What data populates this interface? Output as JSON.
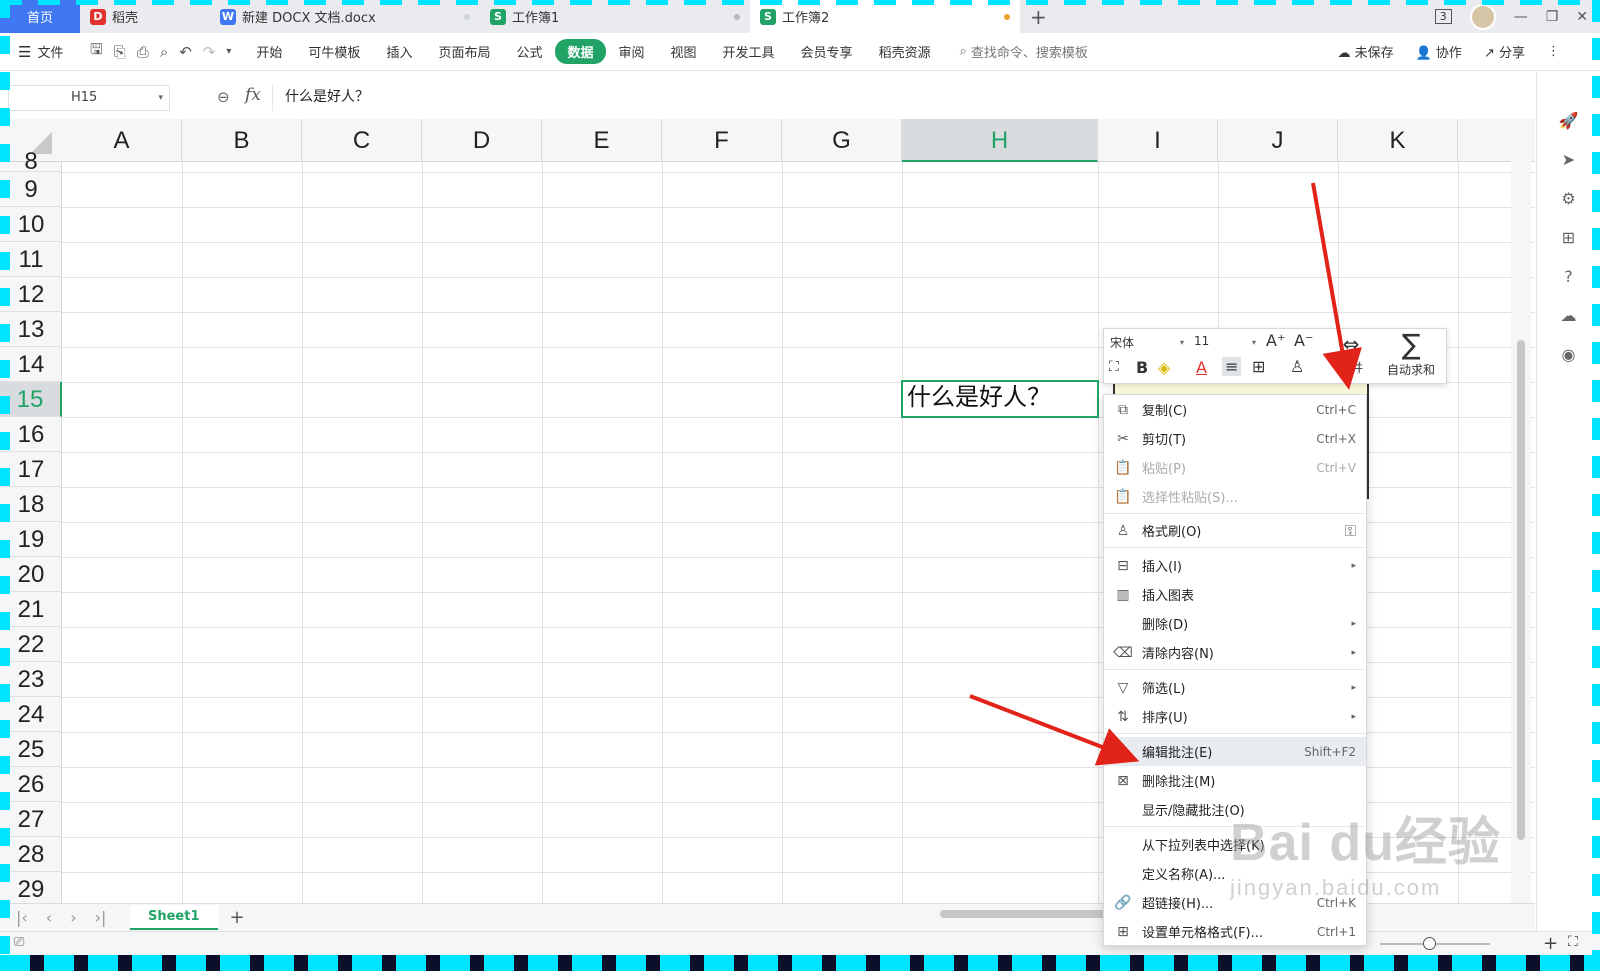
{
  "tabs": [
    {
      "label": "首页",
      "icon": "home"
    },
    {
      "label": "稻壳",
      "icon": "docer-icon",
      "badge": "D"
    },
    {
      "label": "新建 DOCX 文档.docx",
      "icon": "word-icon",
      "badge": "W"
    },
    {
      "label": "工作簿1",
      "icon": "sheet-icon",
      "badge": "S"
    },
    {
      "label": "工作簿2",
      "icon": "sheet-icon",
      "badge": "S"
    }
  ],
  "tabbar_right": {
    "counter": "3"
  },
  "ribbon": {
    "file_label": "文件",
    "tabs": [
      "开始",
      "可牛模板",
      "插入",
      "页面布局",
      "公式",
      "数据",
      "审阅",
      "视图",
      "开发工具",
      "会员专享",
      "稻壳资源"
    ],
    "active_tab": "数据",
    "search_placeholder": "查找命令、搜索模板",
    "right": {
      "unsaved": "未保存",
      "collab": "协作",
      "share": "分享"
    }
  },
  "formula_bar": {
    "cell_ref": "H15",
    "fx": "fx",
    "content": "什么是好人？"
  },
  "columns": [
    "A",
    "B",
    "C",
    "D",
    "E",
    "F",
    "G",
    "H",
    "I",
    "J",
    "K"
  ],
  "selected_column": "H",
  "rows": [
    "8",
    "9",
    "10",
    "11",
    "12",
    "13",
    "14",
    "15",
    "16",
    "17",
    "18",
    "19",
    "20",
    "21",
    "22",
    "23",
    "24",
    "25",
    "26",
    "27",
    "28",
    "29"
  ],
  "selected_row": "15",
  "active_cell": {
    "ref": "H15",
    "value": "什么是好人？"
  },
  "mini_toolbar": {
    "font": "宋体",
    "size": "11",
    "merge_label": "合并",
    "autosum_label": "自动求和"
  },
  "context_menu": {
    "items": [
      {
        "label": "复制(C)",
        "shortcut": "Ctrl+C",
        "icon": "copy-icon",
        "disabled": false
      },
      {
        "label": "剪切(T)",
        "shortcut": "Ctrl+X",
        "icon": "cut-icon",
        "disabled": false
      },
      {
        "label": "粘贴(P)",
        "shortcut": "Ctrl+V",
        "icon": "paste-icon",
        "disabled": true
      },
      {
        "label": "选择性粘贴(S)...",
        "shortcut": "",
        "icon": "paste-special-icon",
        "disabled": true
      },
      {
        "label": "格式刷(O)",
        "shortcut": "",
        "icon": "format-painter-icon",
        "disabled": false
      },
      {
        "label": "插入(I)",
        "shortcut": "",
        "icon": "insert-icon",
        "disabled": false,
        "submenu": true
      },
      {
        "label": "插入图表",
        "shortcut": "",
        "icon": "chart-icon",
        "disabled": false
      },
      {
        "label": "删除(D)",
        "shortcut": "",
        "icon": "",
        "disabled": false,
        "submenu": true
      },
      {
        "label": "清除内容(N)",
        "shortcut": "",
        "icon": "eraser-icon",
        "disabled": false,
        "submenu": true
      },
      {
        "label": "筛选(L)",
        "shortcut": "",
        "icon": "filter-icon",
        "disabled": false,
        "submenu": true
      },
      {
        "label": "排序(U)",
        "shortcut": "",
        "icon": "sort-icon",
        "disabled": false,
        "submenu": true
      },
      {
        "label": "编辑批注(E)",
        "shortcut": "Shift+F2",
        "icon": "edit-comment-icon",
        "disabled": false,
        "highlighted": true
      },
      {
        "label": "删除批注(M)",
        "shortcut": "",
        "icon": "delete-comment-icon",
        "disabled": false
      },
      {
        "label": "显示/隐藏批注(O)",
        "shortcut": "",
        "icon": "",
        "disabled": false
      },
      {
        "label": "从下拉列表中选择(K)",
        "shortcut": "",
        "icon": "",
        "disabled": false
      },
      {
        "label": "定义名称(A)...",
        "shortcut": "",
        "icon": "",
        "disabled": false
      },
      {
        "label": "超链接(H)...",
        "shortcut": "Ctrl+K",
        "icon": "link-icon",
        "disabled": false
      },
      {
        "label": "设置单元格格式(F)...",
        "shortcut": "Ctrl+1",
        "icon": "format-cells-icon",
        "disabled": false
      }
    ]
  },
  "sheet_tabs": {
    "active": "Sheet1"
  },
  "status": {
    "zoom_percent": 85
  },
  "watermark": {
    "big": "Bai du经验",
    "small": "jingyan.baidu.com"
  },
  "colors": {
    "accent": "#21a366",
    "home_tab": "#3f78f2",
    "arrow": "#e2231a",
    "comment_bg": "#fffee1"
  }
}
